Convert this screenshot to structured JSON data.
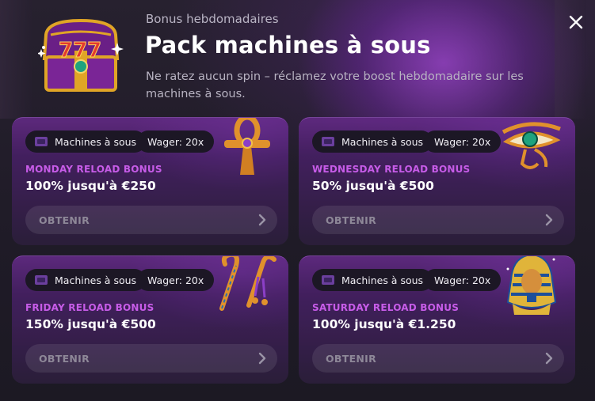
{
  "header": {
    "subtitle": "Bonus hebdomadaires",
    "title": "Pack machines à sous",
    "description": "Ne ratez aucun spin – réclamez votre boost hebdomadaire sur les machines à sous.",
    "close_icon": "close-icon",
    "image_icon": "treasure-chest-icon"
  },
  "cards": [
    {
      "tag": "Machines à sous",
      "wager": "Wager: 20x",
      "name": "MONDAY RELOAD BONUS",
      "value": "100% jusqu'à €250",
      "button": "OBTENIR",
      "art": "ankh-icon"
    },
    {
      "tag": "Machines à sous",
      "wager": "Wager: 20x",
      "name": "WEDNESDAY RELOAD BONUS",
      "value": "50% jusqu'à €500",
      "button": "OBTENIR",
      "art": "eye-of-horus-icon"
    },
    {
      "tag": "Machines à sous",
      "wager": "Wager: 20x",
      "name": "FRIDAY RELOAD BONUS",
      "value": "150% jusqu'à €500",
      "button": "OBTENIR",
      "art": "crook-and-flail-icon"
    },
    {
      "tag": "Machines à sous",
      "wager": "Wager: 20x",
      "name": "SATURDAY RELOAD BONUS",
      "value": "100% jusqu'à €1.250",
      "button": "OBTENIR",
      "art": "pharaoh-bust-icon"
    }
  ],
  "colors": {
    "accent": "#c75ce8",
    "card": "#622a84",
    "background": "#1d1a26"
  }
}
